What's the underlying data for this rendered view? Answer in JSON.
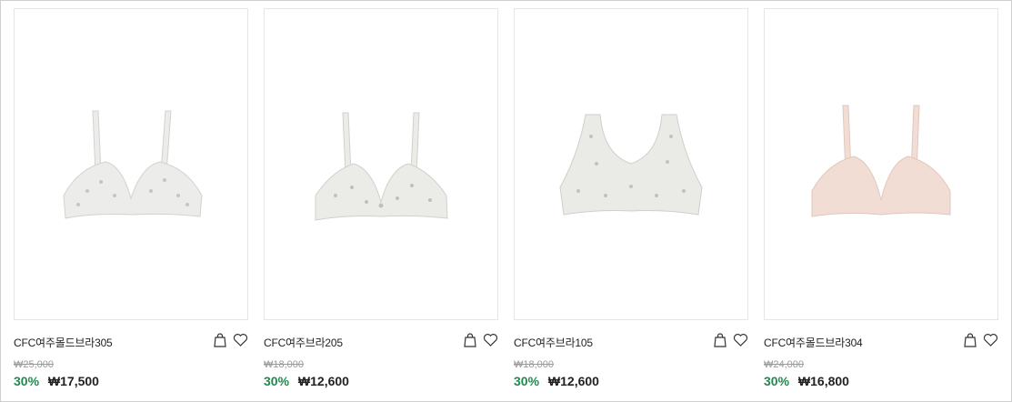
{
  "products": [
    {
      "name": "CFC여주몰드브라305",
      "original_price": "₩25,000",
      "discount": "30%",
      "price": "₩17,500",
      "color": "#ececea",
      "style": "molded",
      "icons": [
        "shopping-bag-icon",
        "heart-icon"
      ]
    },
    {
      "name": "CFC여주브라205",
      "original_price": "₩18,000",
      "discount": "30%",
      "price": "₩12,600",
      "color": "#ebebe8",
      "style": "soft",
      "icons": [
        "shopping-bag-icon",
        "heart-icon"
      ]
    },
    {
      "name": "CFC여주브라105",
      "original_price": "₩18,000",
      "discount": "30%",
      "price": "₩12,600",
      "color": "#eaeae7",
      "style": "tank",
      "icons": [
        "shopping-bag-icon",
        "heart-icon"
      ]
    },
    {
      "name": "CFC여주몰드브라304",
      "original_price": "₩24,000",
      "discount": "30%",
      "price": "₩16,800",
      "color": "#f1ddd3",
      "style": "molded",
      "icons": [
        "shopping-bag-icon",
        "heart-icon"
      ]
    }
  ],
  "colors": {
    "discount": "#1f8a4c",
    "text": "#222222",
    "strike": "#9a9a9a"
  }
}
